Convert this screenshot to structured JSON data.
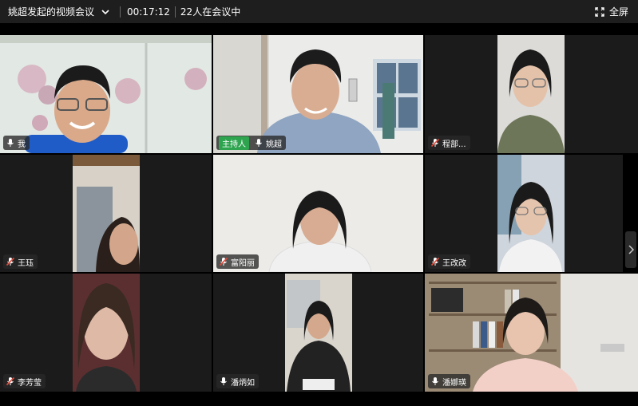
{
  "titlebar": {
    "meeting_title": "姚超发起的视频会议",
    "timer": "00:17:12",
    "participants": "22人在会议中",
    "fullscreen_label": "全屏"
  },
  "tiles": [
    {
      "name": "我",
      "mic": "on",
      "host": false
    },
    {
      "name": "姚超",
      "mic": "on",
      "host": true,
      "host_label": "主持人"
    },
    {
      "name": "程部...",
      "mic": "muted",
      "host": false
    },
    {
      "name": "王珏",
      "mic": "muted",
      "host": false
    },
    {
      "name": "富阳丽",
      "mic": "muted",
      "host": false
    },
    {
      "name": "王改改",
      "mic": "muted",
      "host": false
    },
    {
      "name": "李芳莹",
      "mic": "muted",
      "host": false
    },
    {
      "name": "潘炳如",
      "mic": "on",
      "host": false
    },
    {
      "name": "潘娜瑛",
      "mic": "on",
      "host": false
    }
  ],
  "colors": {
    "titlebar_bg": "#1e1e1e",
    "host_badge": "#2ea44f",
    "muted_mic": "#e34b3b"
  }
}
